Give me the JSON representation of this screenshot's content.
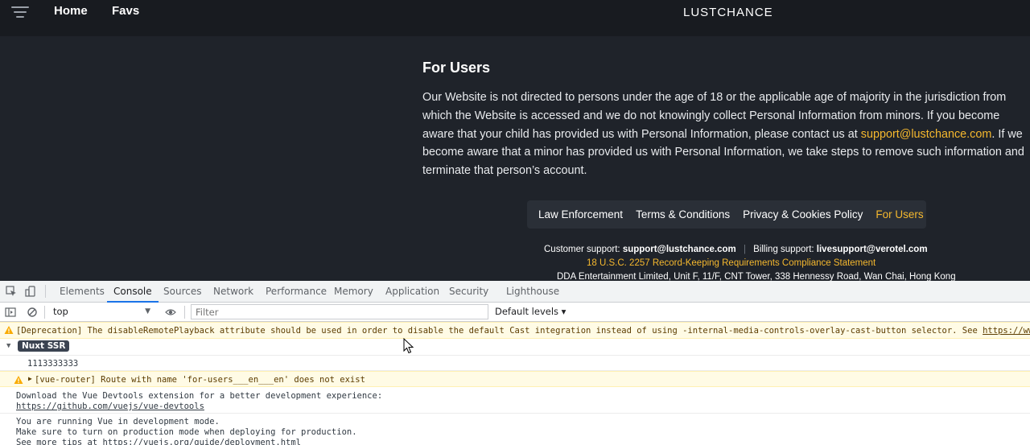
{
  "site": {
    "nav": {
      "home": "Home",
      "favs": "Favs"
    },
    "logo": "LUSTCHANCE",
    "section_title": "For Users",
    "paragraph_before": "Our Website is not directed to persons under the age of 18 or the applicable age of majority in the jurisdiction from which the Website is accessed and we do not knowingly collect Personal Information from minors. If you become aware that your child has provided us with Personal Information, please contact us at ",
    "paragraph_link": "support@lustchance.com",
    "paragraph_after": ". If we become aware that a minor has provided us with Personal Information, we take steps to remove such information and terminate that person’s account.",
    "footer_links": [
      "Law Enforcement",
      "Terms & Conditions",
      "Privacy & Cookies Policy",
      "For Users"
    ],
    "support": {
      "customer_label": "Customer support:",
      "customer_email": "support@lustchance.com",
      "billing_label": "Billing support:",
      "billing_email": "livesupport@verotel.com"
    },
    "compliance": "18 U.S.C. 2257 Record-Keeping Requirements Compliance Statement",
    "address": "DDA Entertainment Limited, Unit F, 11/F, CNT Tower, 338 Hennessy Road, Wan Chai, Hong Kong",
    "colors": {
      "accent": "#f5b82e",
      "background": "#1f232a",
      "topbar": "#181b20"
    }
  },
  "devtools": {
    "tabs": [
      "Elements",
      "Console",
      "Sources",
      "Network",
      "Performance",
      "Memory",
      "Application",
      "Security",
      "Lighthouse"
    ],
    "active_tab": "Console",
    "context": "top",
    "filter_placeholder": "Filter",
    "levels": "Default levels ▾",
    "messages": {
      "deprecation": "[Deprecation] The disableRemotePlayback attribute should be used in order to disable the default Cast integration instead of using -internal-media-controls-overlay-cast-button selector. See ",
      "deprecation_link": "https://www.",
      "nuxt_badge": "Nuxt SSR",
      "number": "1113333333",
      "router_warning": "[vue-router] Route with name 'for-users___en___en' does not exist",
      "devtools_line1": "Download the Vue Devtools extension for a better development experience:",
      "devtools_link": "https://github.com/vuejs/vue-devtools",
      "dev_mode_line1": "You are running Vue in development mode.",
      "dev_mode_line2": "Make sure to turn on production mode when deploying for production.",
      "dev_mode_line3": "See more tips at https://vuejs.org/guide/deployment.html"
    }
  }
}
